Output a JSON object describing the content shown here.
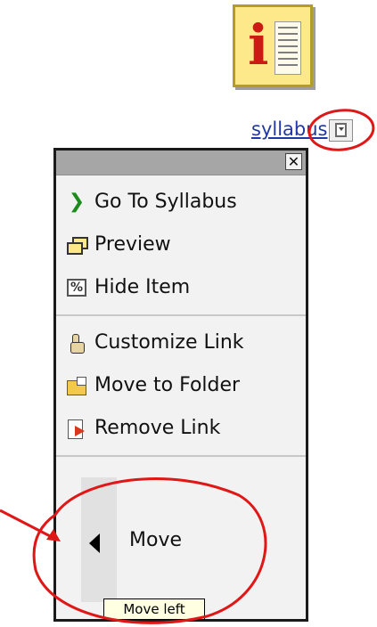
{
  "item": {
    "link_text": "syllabus",
    "tile_glyph": "i",
    "tile_icon": "syllabus-list-icon",
    "menu_trigger_icon": "dropdown-menu-icon"
  },
  "popup": {
    "close_glyph": "✕",
    "sections": [
      [
        {
          "label": "Go To Syllabus",
          "icon": "chevron-right-icon"
        },
        {
          "label": "Preview",
          "icon": "preview-windows-icon"
        },
        {
          "label": "Hide Item",
          "icon": "hide-item-icon"
        }
      ],
      [
        {
          "label": "Customize Link",
          "icon": "hand-pointer-icon"
        },
        {
          "label": "Move to Folder",
          "icon": "move-folder-icon"
        },
        {
          "label": "Remove Link",
          "icon": "remove-link-icon"
        }
      ]
    ],
    "move": {
      "label": "Move",
      "icon": "left-arrow-icon"
    }
  },
  "tooltip": {
    "text": "Move left"
  },
  "colors": {
    "annotation": "#e01717",
    "link": "#1f38a6",
    "tile_bg": "#fde98a",
    "accent_i": "#cc1a14"
  }
}
